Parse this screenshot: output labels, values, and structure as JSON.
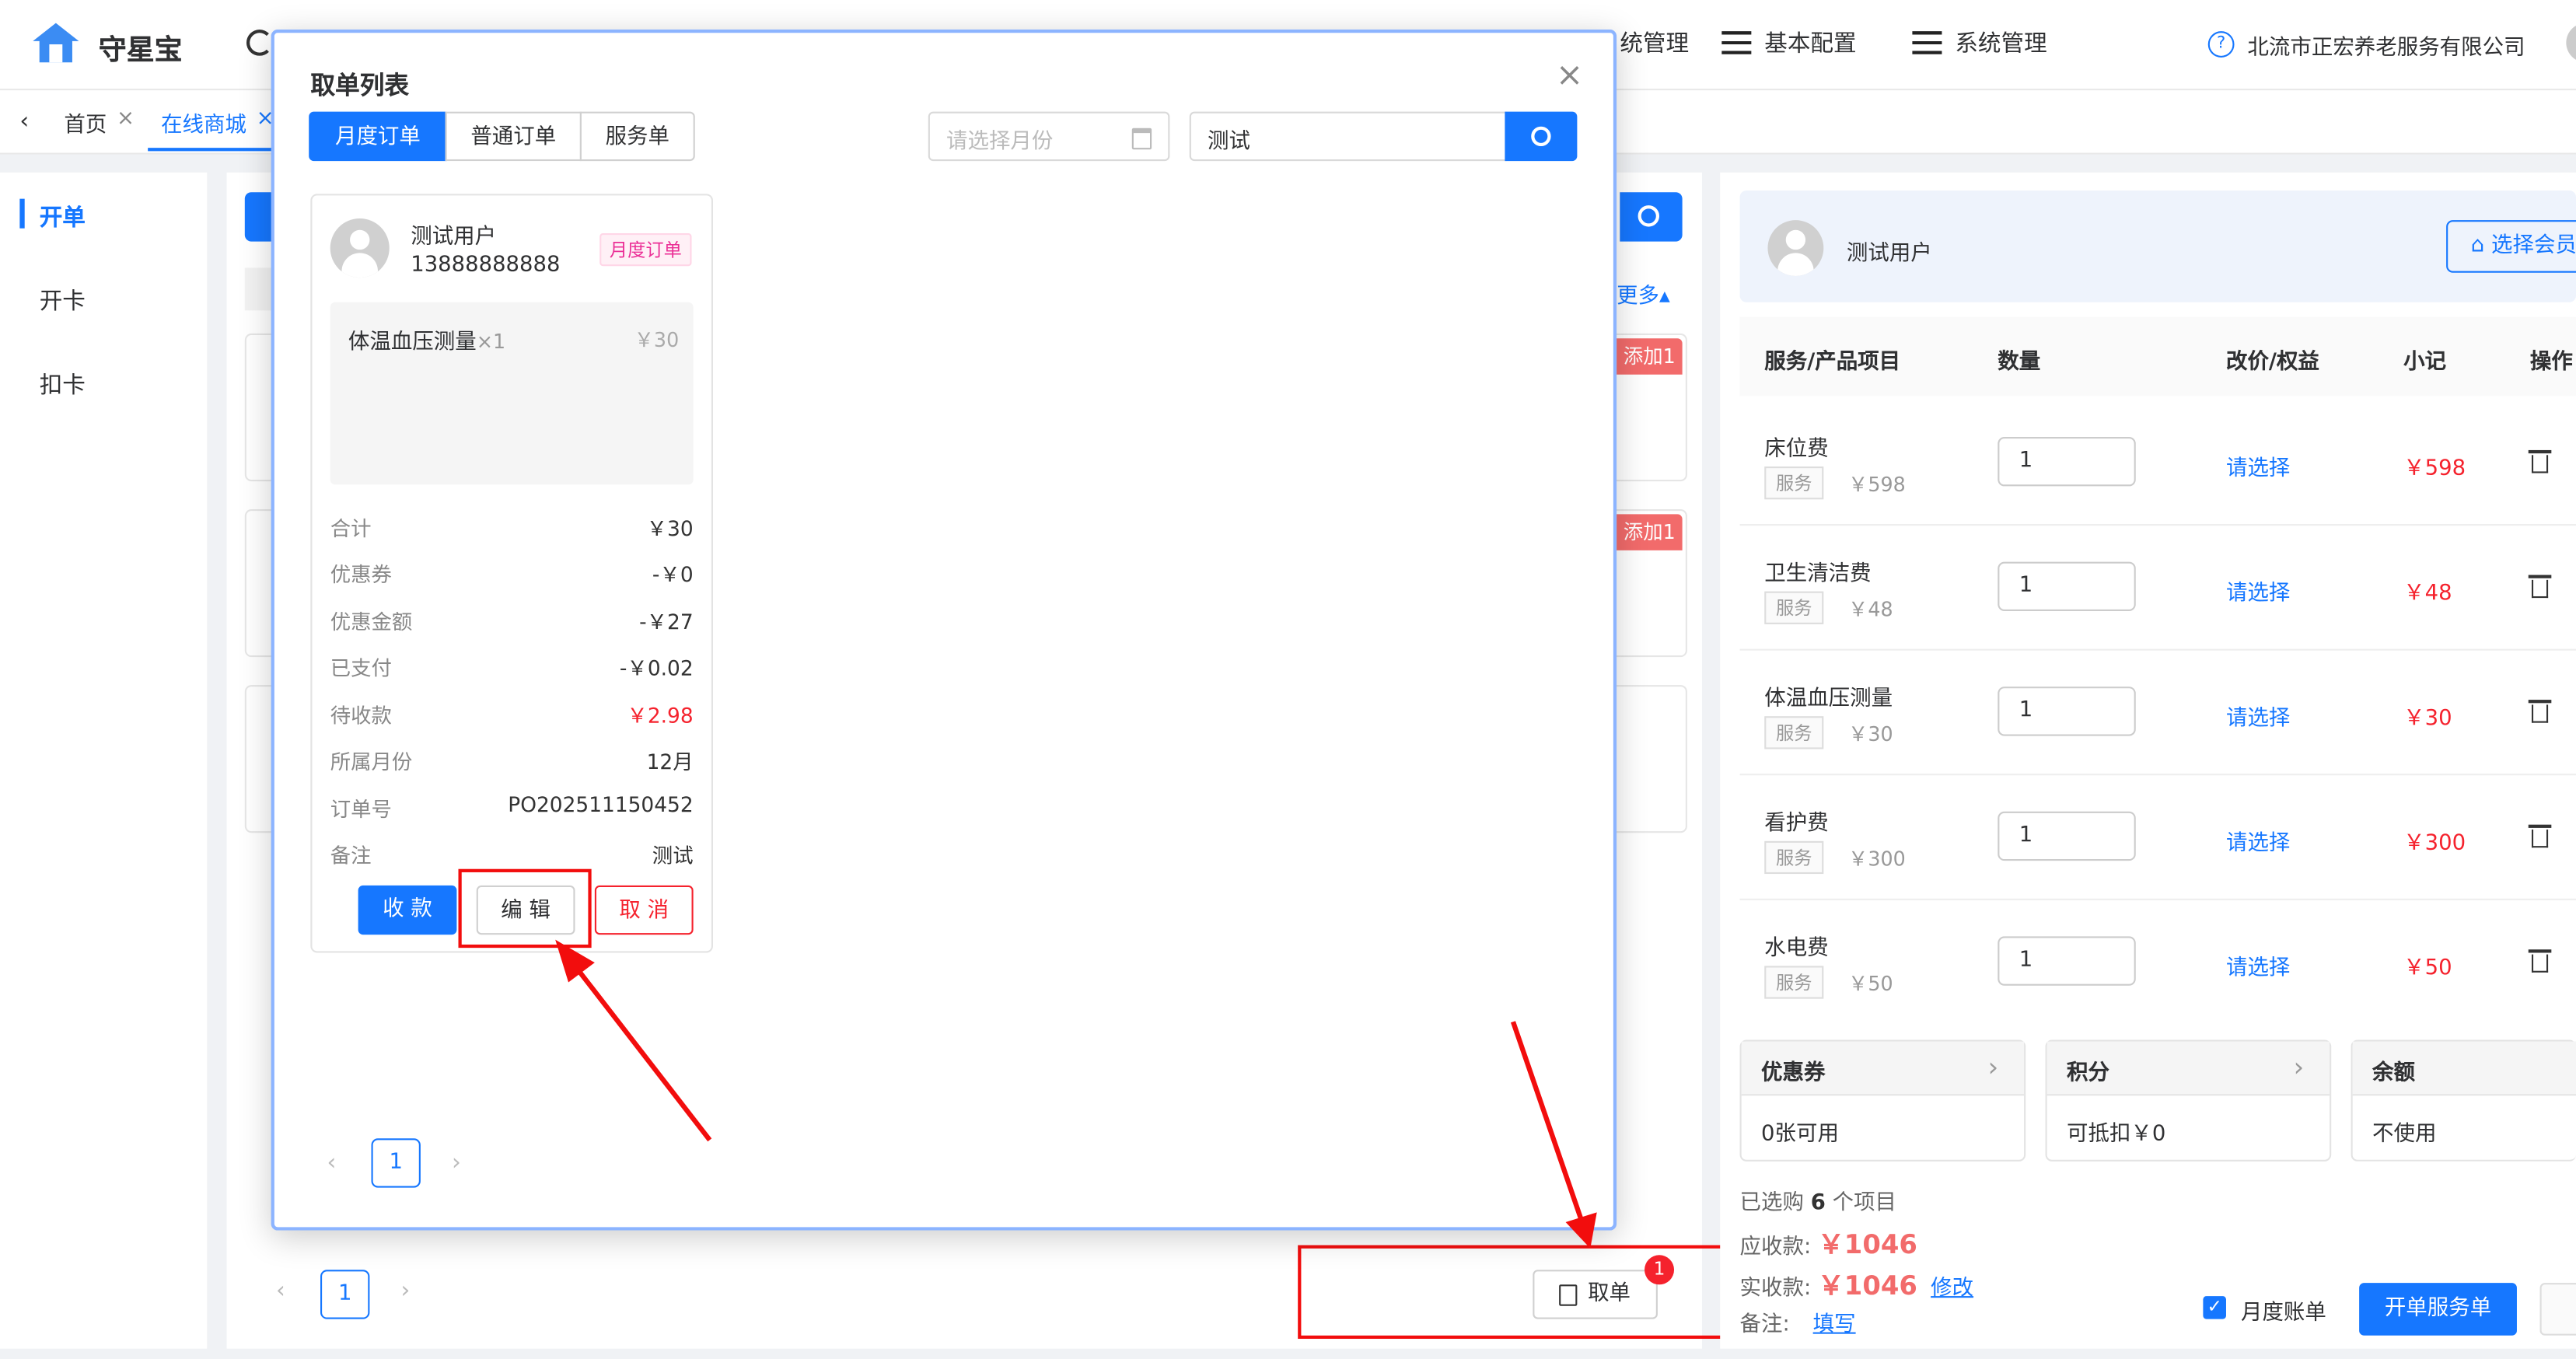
{
  "header": {
    "app_name": "守星宝",
    "nav": [
      {
        "label": "系统管理",
        "partial": "统管理"
      },
      {
        "label": "基本配置"
      },
      {
        "label": "系统管理"
      }
    ],
    "nav_partial_label": "统管理",
    "nav_label_2": "基本配置",
    "nav_label_3": "系统管理",
    "org_name": "北流市正宏养老服务有限公司"
  },
  "breadcrumb_tabs": {
    "back_icon": "chevron-left-icon",
    "tab_home": "首页",
    "tab_mall": "在线商城"
  },
  "sidebar": {
    "items": [
      {
        "label": "开单",
        "active": true
      },
      {
        "label": "开卡"
      },
      {
        "label": "扣卡"
      }
    ]
  },
  "middle": {
    "more_label": "更多",
    "add_badge": "添加1",
    "pager_current": "1",
    "take_order_label": "取单",
    "take_order_count": "1"
  },
  "right": {
    "member_name": "测试用户",
    "select_member_label": "选择会员",
    "columns": [
      "服务/产品项目",
      "数量",
      "改价/权益",
      "小记",
      "操作"
    ],
    "rows": [
      {
        "name": "床位费",
        "tag": "服务",
        "price": "￥598",
        "qty": "1",
        "action": "请选择",
        "subtotal": "￥598"
      },
      {
        "name": "卫生清洁费",
        "tag": "服务",
        "price": "￥48",
        "qty": "1",
        "action": "请选择",
        "subtotal": "￥48"
      },
      {
        "name": "体温血压测量",
        "tag": "服务",
        "price": "￥30",
        "qty": "1",
        "action": "请选择",
        "subtotal": "￥30"
      },
      {
        "name": "看护费",
        "tag": "服务",
        "price": "￥300",
        "qty": "1",
        "action": "请选择",
        "subtotal": "￥300"
      },
      {
        "name": "水电费",
        "tag": "服务",
        "price": "￥50",
        "qty": "1",
        "action": "请选择",
        "subtotal": "￥50"
      }
    ],
    "coupon": {
      "title": "优惠券",
      "value": "0张可用"
    },
    "points": {
      "title": "积分",
      "value": "可抵扣￥0"
    },
    "balance": {
      "title": "余额",
      "value": "不使用"
    },
    "selected_prefix": "已选购",
    "selected_count": "6",
    "selected_suffix": "个项目",
    "receivable_label": "应收款:",
    "receivable_value": "￥1046",
    "actual_label": "实收款:",
    "actual_value": "￥1046",
    "modify_label": "修改",
    "remark_label": "备注:",
    "remark_fill": "填写",
    "monthly_bill_label": "月度账单",
    "monthly_bill_checked": true,
    "open_service_label": "开单服务单"
  },
  "modal": {
    "title": "取单列表",
    "tabs": [
      "月度订单",
      "普通订单",
      "服务单"
    ],
    "active_tab": 0,
    "month_placeholder": "请选择月份",
    "search_value": "测试",
    "order": {
      "user_name": "测试用户",
      "phone": "13888888888",
      "type_tag": "月度订单",
      "item_name": "体温血压测量",
      "item_qty": "×1",
      "item_price": "￥30",
      "fields": [
        {
          "label": "合计",
          "value": "￥30"
        },
        {
          "label": "优惠券",
          "value": "-￥0"
        },
        {
          "label": "优惠金额",
          "value": "-￥27"
        },
        {
          "label": "已支付",
          "value": "-￥0.02"
        },
        {
          "label": "待收款",
          "value": "￥2.98"
        },
        {
          "label": "所属月份",
          "value": "12月"
        },
        {
          "label": "订单号",
          "value": "PO202511150452"
        },
        {
          "label": "备注",
          "value": "测试"
        }
      ],
      "btn_collect": "收 款",
      "btn_edit": "编 辑",
      "btn_cancel": "取 消"
    },
    "pager_current": "1"
  },
  "colors": {
    "accent": "#1677ff",
    "danger": "#f5222d",
    "annotation": "#f20d0d"
  }
}
